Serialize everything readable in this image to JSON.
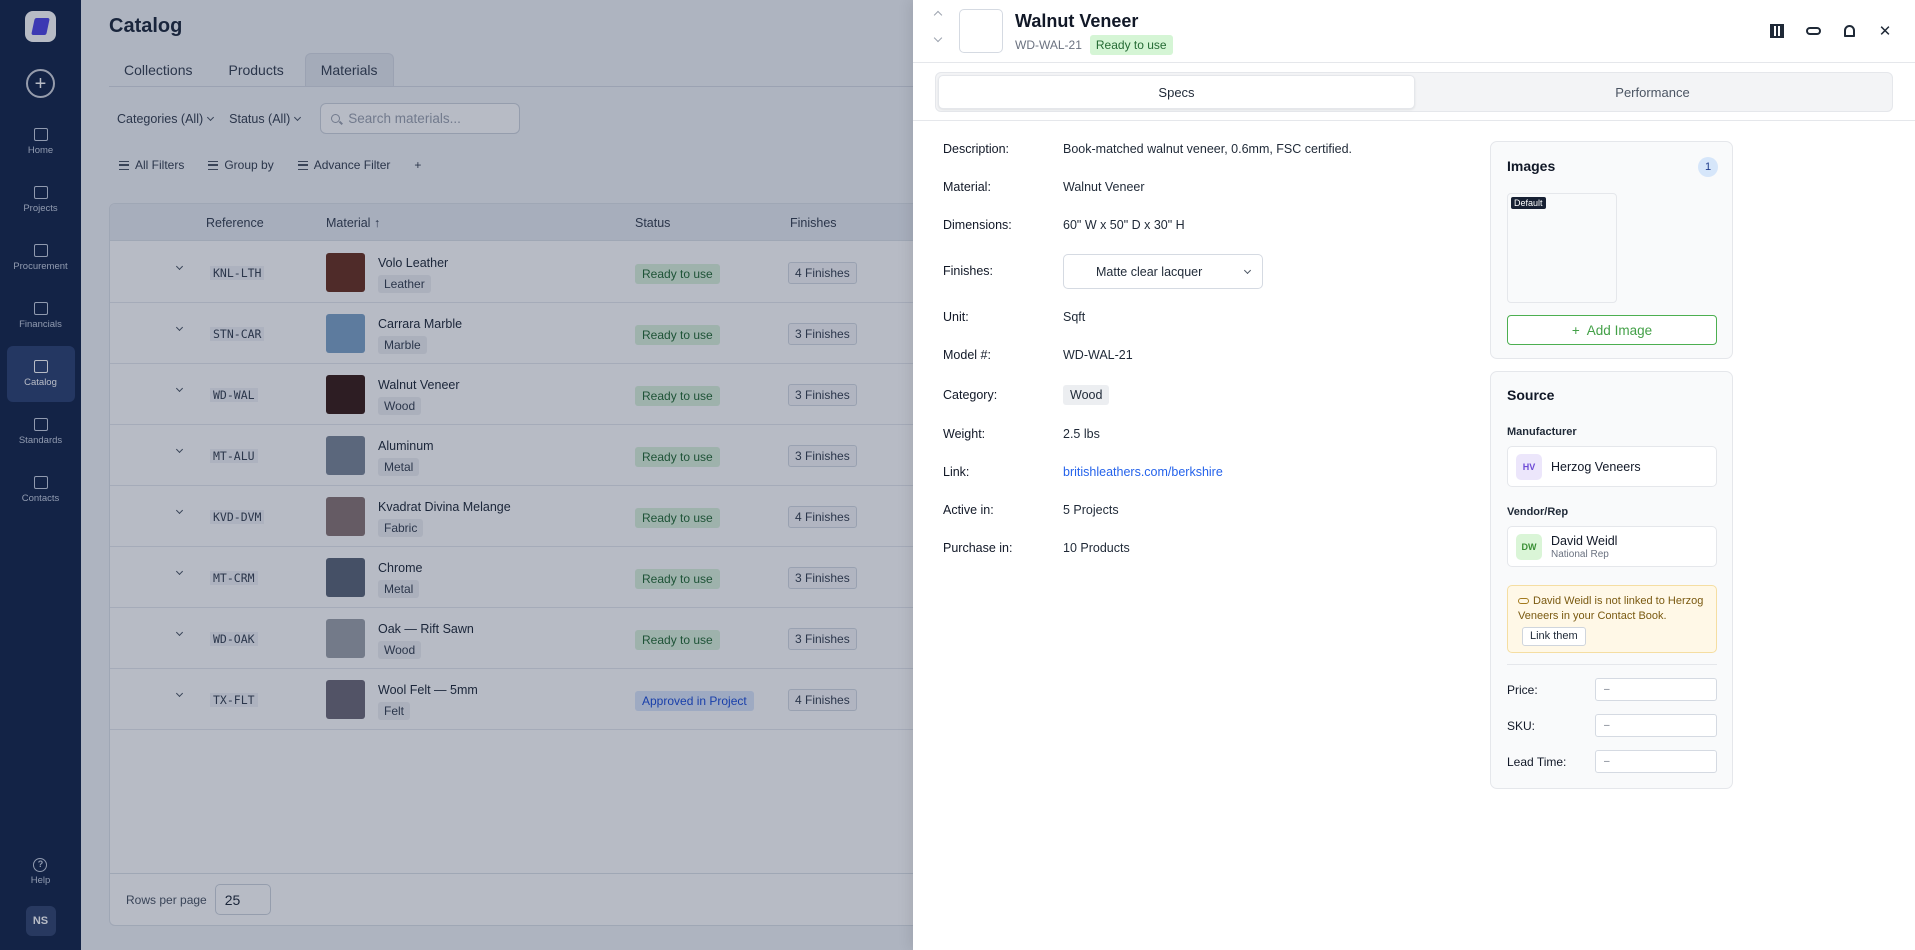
{
  "sidebar": {
    "logo": "app-logo",
    "items": [
      {
        "label": "Home",
        "icon": "home-icon"
      },
      {
        "label": "Projects",
        "icon": "folder-icon"
      },
      {
        "label": "Procurement",
        "icon": "procurement-icon"
      },
      {
        "label": "Financials",
        "icon": "wallet-icon"
      },
      {
        "label": "Catalog",
        "icon": "box-icon",
        "active": true
      },
      {
        "label": "Standards",
        "icon": "list-icon"
      },
      {
        "label": "Contacts",
        "icon": "contact-icon"
      }
    ],
    "help_label": "Help",
    "avatar_initials": "NS"
  },
  "page": {
    "title": "Catalog",
    "tabs": [
      "Collections",
      "Products",
      "Materials"
    ],
    "active_tab": "Materials"
  },
  "filters": {
    "categories": "Categories (All)",
    "status": "Status (All)",
    "search_placeholder": "Search materials..."
  },
  "toolbar": {
    "all_filters": "All Filters",
    "group_by": "Group by",
    "advance_filter": "Advance Filter",
    "add": "+"
  },
  "table": {
    "columns": [
      "Reference",
      "Material",
      "Status",
      "Finishes"
    ],
    "sort_indicator": "↑",
    "rows": [
      {
        "ref": "KNL-LTH",
        "name": "Volo Leather",
        "category": "Leather",
        "status": "Ready to use",
        "finishes": "4 Finishes",
        "color": "#6b3220"
      },
      {
        "ref": "STN-CAR",
        "name": "Carrara Marble",
        "category": "Marble",
        "status": "Ready to use",
        "finishes": "3 Finishes",
        "color": "#7ea4c8"
      },
      {
        "ref": "WD-WAL",
        "name": "Walnut Veneer",
        "category": "Wood",
        "status": "Ready to use",
        "finishes": "3 Finishes",
        "color": "#3a1e18"
      },
      {
        "ref": "MT-ALU",
        "name": "Aluminum",
        "category": "Metal",
        "status": "Ready to use",
        "finishes": "3 Finishes",
        "color": "#7c8797"
      },
      {
        "ref": "KVD-DVM",
        "name": "Kvadrat Divina Melange",
        "category": "Fabric",
        "status": "Ready to use",
        "finishes": "4 Finishes",
        "color": "#8a7674"
      },
      {
        "ref": "MT-CRM",
        "name": "Chrome",
        "category": "Metal",
        "status": "Ready to use",
        "finishes": "3 Finishes",
        "color": "#5c6677"
      },
      {
        "ref": "WD-OAK",
        "name": "Oak — Rift Sawn",
        "category": "Wood",
        "status": "Ready to use",
        "finishes": "3 Finishes",
        "color": "#9ea3aa"
      },
      {
        "ref": "TX-FLT",
        "name": "Wool Felt — 5mm",
        "category": "Felt",
        "status": "Approved in Project",
        "finishes": "4 Finishes",
        "color": "#6f6a78"
      }
    ],
    "rows_per_page_label": "Rows per page",
    "rows_per_page": "25"
  },
  "drawer": {
    "title": "Walnut Veneer",
    "code": "WD-WAL-21",
    "status": "Ready to use",
    "tabs": [
      "Specs",
      "Performance"
    ],
    "active_tab": "Specs",
    "specs": {
      "description_label": "Description:",
      "description": "Book-matched walnut veneer, 0.6mm, FSC certified.",
      "material_label": "Material:",
      "material": "Walnut Veneer",
      "dimensions_label": "Dimensions:",
      "dimensions": "60\" W x 50\" D x 30\" H",
      "finishes_label": "Finishes:",
      "finishes": "Matte clear lacquer",
      "unit_label": "Unit:",
      "unit": "Sqft",
      "model_label": "Model #:",
      "model": "WD-WAL-21",
      "category_label": "Category:",
      "category": "Wood",
      "weight_label": "Weight:",
      "weight": "2.5 lbs",
      "link_label": "Link:",
      "link": "britishleathers.com/berkshire",
      "active_label": "Active in:",
      "active": "5 Projects",
      "purchase_label": "Purchase in:",
      "purchase": "10 Products"
    },
    "images": {
      "title": "Images",
      "count": "1",
      "default_tag": "Default",
      "add_label": "Add Image"
    },
    "source": {
      "title": "Source",
      "manufacturer_label": "Manufacturer",
      "manufacturer_initials": "HV",
      "manufacturer_name": "Herzog Veneers",
      "vendor_label": "Vendor/Rep",
      "vendor_initials": "DW",
      "vendor_name": "David Weidl",
      "vendor_role": "National Rep",
      "warning": "David Weidl is not linked to Herzog Veneers in your Contact Book.",
      "link_them": "Link them",
      "price_label": "Price:",
      "price": "–",
      "sku_label": "SKU:",
      "sku": "–",
      "lead_label": "Lead Time:",
      "lead": "–"
    }
  }
}
